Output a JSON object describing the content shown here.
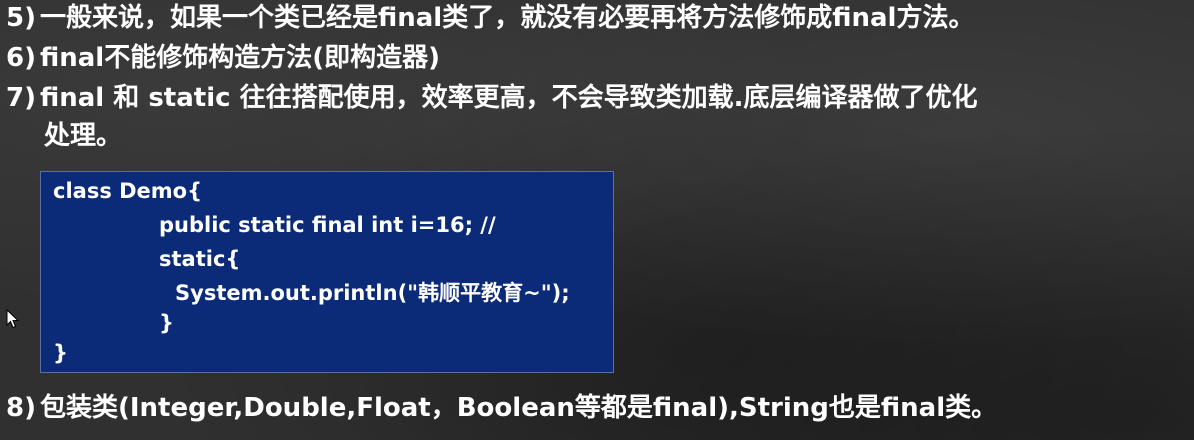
{
  "slide": {
    "points": [
      {
        "num": "5)",
        "text": "一般来说，如果一个类已经是final类了，就没有必要再将方法修饰成final方法。"
      },
      {
        "num": "6)",
        "text": "final不能修饰构造方法(即构造器)"
      },
      {
        "num": "7)",
        "text": "final 和 static 往往搭配使用，效率更高，不会导致类加载.底层编译器做了优化",
        "continuation": "处理。"
      },
      {
        "num": "8)",
        "text": "包装类(Integer,Double,Float，Boolean等都是final),String也是final类。"
      }
    ],
    "code_lines": [
      "class Demo{",
      "public static final int i=16; //",
      "static{",
      "System.out.println(\"韩顺平教育~\");",
      "}",
      "}"
    ],
    "colors": {
      "background": "#2f302f",
      "code_background": "#0b2a78",
      "text": "#ffffff"
    },
    "icons": {
      "cursor": "mouse-pointer-icon"
    }
  }
}
